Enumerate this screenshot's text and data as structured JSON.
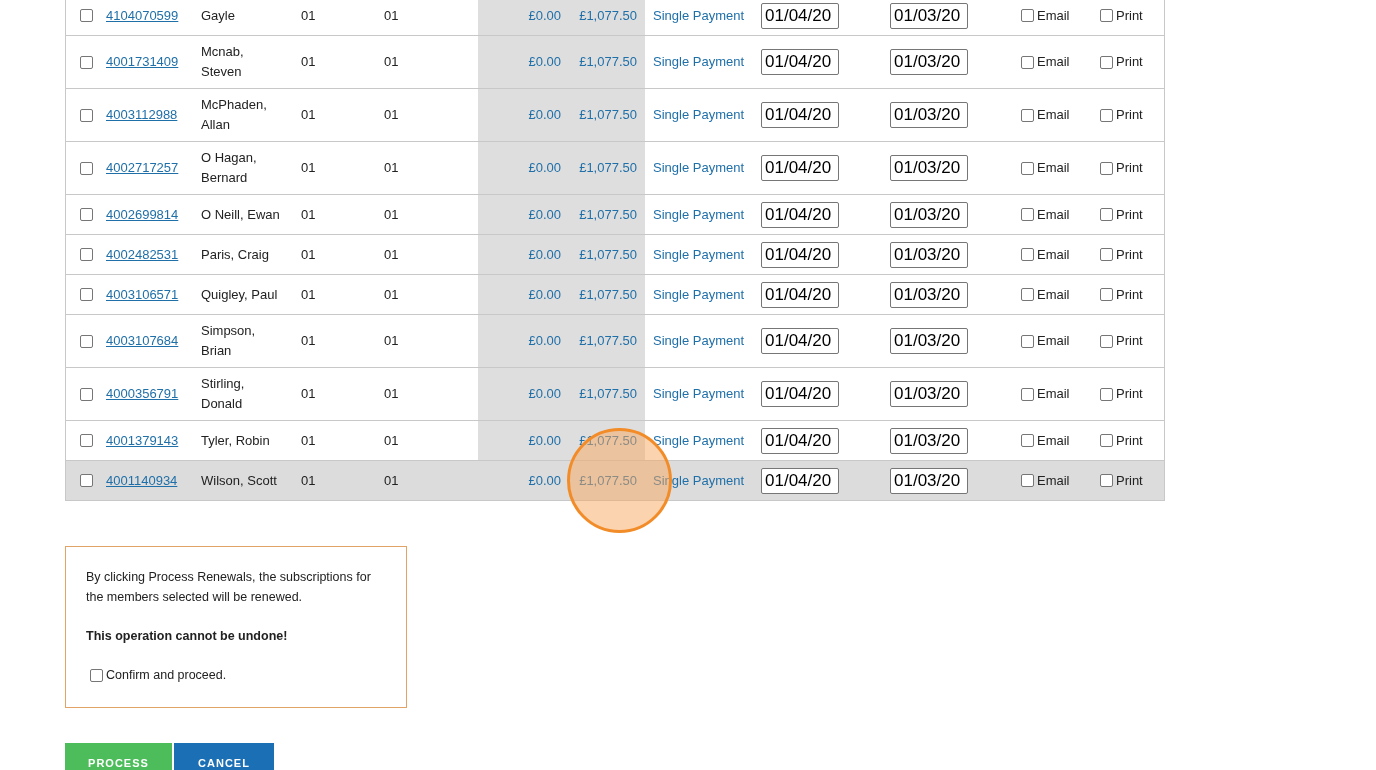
{
  "table": {
    "rows": [
      {
        "selected": false,
        "member_id": "4104070599",
        "name": "Gayle",
        "column_3": "01",
        "column_4": "01",
        "amount_1": "£0.00",
        "amount_2": "£1,077.50",
        "payment": "Single Payment",
        "date_1": "01/04/20",
        "date_2": "01/03/20",
        "email": {
          "label": "Email",
          "checked": false
        },
        "print": {
          "label": "Print",
          "checked": false
        },
        "highlighted": false
      },
      {
        "selected": false,
        "member_id": "4001731409",
        "name": "Mcnab, Steven",
        "column_3": "01",
        "column_4": "01",
        "amount_1": "£0.00",
        "amount_2": "£1,077.50",
        "payment": "Single Payment",
        "date_1": "01/04/20",
        "date_2": "01/03/20",
        "email": {
          "label": "Email",
          "checked": false
        },
        "print": {
          "label": "Print",
          "checked": false
        },
        "highlighted": false
      },
      {
        "selected": false,
        "member_id": "4003112988",
        "name": "McPhaden, Allan",
        "column_3": "01",
        "column_4": "01",
        "amount_1": "£0.00",
        "amount_2": "£1,077.50",
        "payment": "Single Payment",
        "date_1": "01/04/20",
        "date_2": "01/03/20",
        "email": {
          "label": "Email",
          "checked": false
        },
        "print": {
          "label": "Print",
          "checked": false
        },
        "highlighted": false
      },
      {
        "selected": false,
        "member_id": "4002717257",
        "name": "O Hagan, Bernard",
        "column_3": "01",
        "column_4": "01",
        "amount_1": "£0.00",
        "amount_2": "£1,077.50",
        "payment": "Single Payment",
        "date_1": "01/04/20",
        "date_2": "01/03/20",
        "email": {
          "label": "Email",
          "checked": false
        },
        "print": {
          "label": "Print",
          "checked": false
        },
        "highlighted": false
      },
      {
        "selected": false,
        "member_id": "4002699814",
        "name": "O Neill, Ewan",
        "column_3": "01",
        "column_4": "01",
        "amount_1": "£0.00",
        "amount_2": "£1,077.50",
        "payment": "Single Payment",
        "date_1": "01/04/20",
        "date_2": "01/03/20",
        "email": {
          "label": "Email",
          "checked": false
        },
        "print": {
          "label": "Print",
          "checked": false
        },
        "highlighted": false
      },
      {
        "selected": false,
        "member_id": "4002482531",
        "name": "Paris, Craig",
        "column_3": "01",
        "column_4": "01",
        "amount_1": "£0.00",
        "amount_2": "£1,077.50",
        "payment": "Single Payment",
        "date_1": "01/04/20",
        "date_2": "01/03/20",
        "email": {
          "label": "Email",
          "checked": false
        },
        "print": {
          "label": "Print",
          "checked": false
        },
        "highlighted": false
      },
      {
        "selected": false,
        "member_id": "4003106571",
        "name": "Quigley, Paul",
        "column_3": "01",
        "column_4": "01",
        "amount_1": "£0.00",
        "amount_2": "£1,077.50",
        "payment": "Single Payment",
        "date_1": "01/04/20",
        "date_2": "01/03/20",
        "email": {
          "label": "Email",
          "checked": false
        },
        "print": {
          "label": "Print",
          "checked": false
        },
        "highlighted": false
      },
      {
        "selected": false,
        "member_id": "4003107684",
        "name": "Simpson, Brian",
        "column_3": "01",
        "column_4": "01",
        "amount_1": "£0.00",
        "amount_2": "£1,077.50",
        "payment": "Single Payment",
        "date_1": "01/04/20",
        "date_2": "01/03/20",
        "email": {
          "label": "Email",
          "checked": false
        },
        "print": {
          "label": "Print",
          "checked": false
        },
        "highlighted": false
      },
      {
        "selected": false,
        "member_id": "4000356791",
        "name": "Stirling, Donald",
        "column_3": "01",
        "column_4": "01",
        "amount_1": "£0.00",
        "amount_2": "£1,077.50",
        "payment": "Single Payment",
        "date_1": "01/04/20",
        "date_2": "01/03/20",
        "email": {
          "label": "Email",
          "checked": false
        },
        "print": {
          "label": "Print",
          "checked": false
        },
        "highlighted": false
      },
      {
        "selected": false,
        "member_id": "4001379143",
        "name": "Tyler, Robin",
        "column_3": "01",
        "column_4": "01",
        "amount_1": "£0.00",
        "amount_2": "£1,077.50",
        "payment": "Single Payment",
        "date_1": "01/04/20",
        "date_2": "01/03/20",
        "email": {
          "label": "Email",
          "checked": false
        },
        "print": {
          "label": "Print",
          "checked": false
        },
        "highlighted": false
      },
      {
        "selected": false,
        "member_id": "4001140934",
        "name": "Wilson, Scott",
        "column_3": "01",
        "column_4": "01",
        "amount_1": "£0.00",
        "amount_2": "£1,077.50",
        "payment": "Single Payment",
        "date_1": "01/04/20",
        "date_2": "01/03/20",
        "email": {
          "label": "Email",
          "checked": false
        },
        "print": {
          "label": "Print",
          "checked": false
        },
        "highlighted": true
      }
    ]
  },
  "notice": {
    "message": "By clicking Process Renewals, the subscriptions for the members selected will be renewed.",
    "warning": "This operation cannot be undone!",
    "confirm": {
      "label": "Confirm and proceed.",
      "checked": false
    }
  },
  "buttons": [
    {
      "label": "PROCESS",
      "kind": "primary"
    },
    {
      "label": "CANCEL",
      "kind": "secondary"
    }
  ]
}
